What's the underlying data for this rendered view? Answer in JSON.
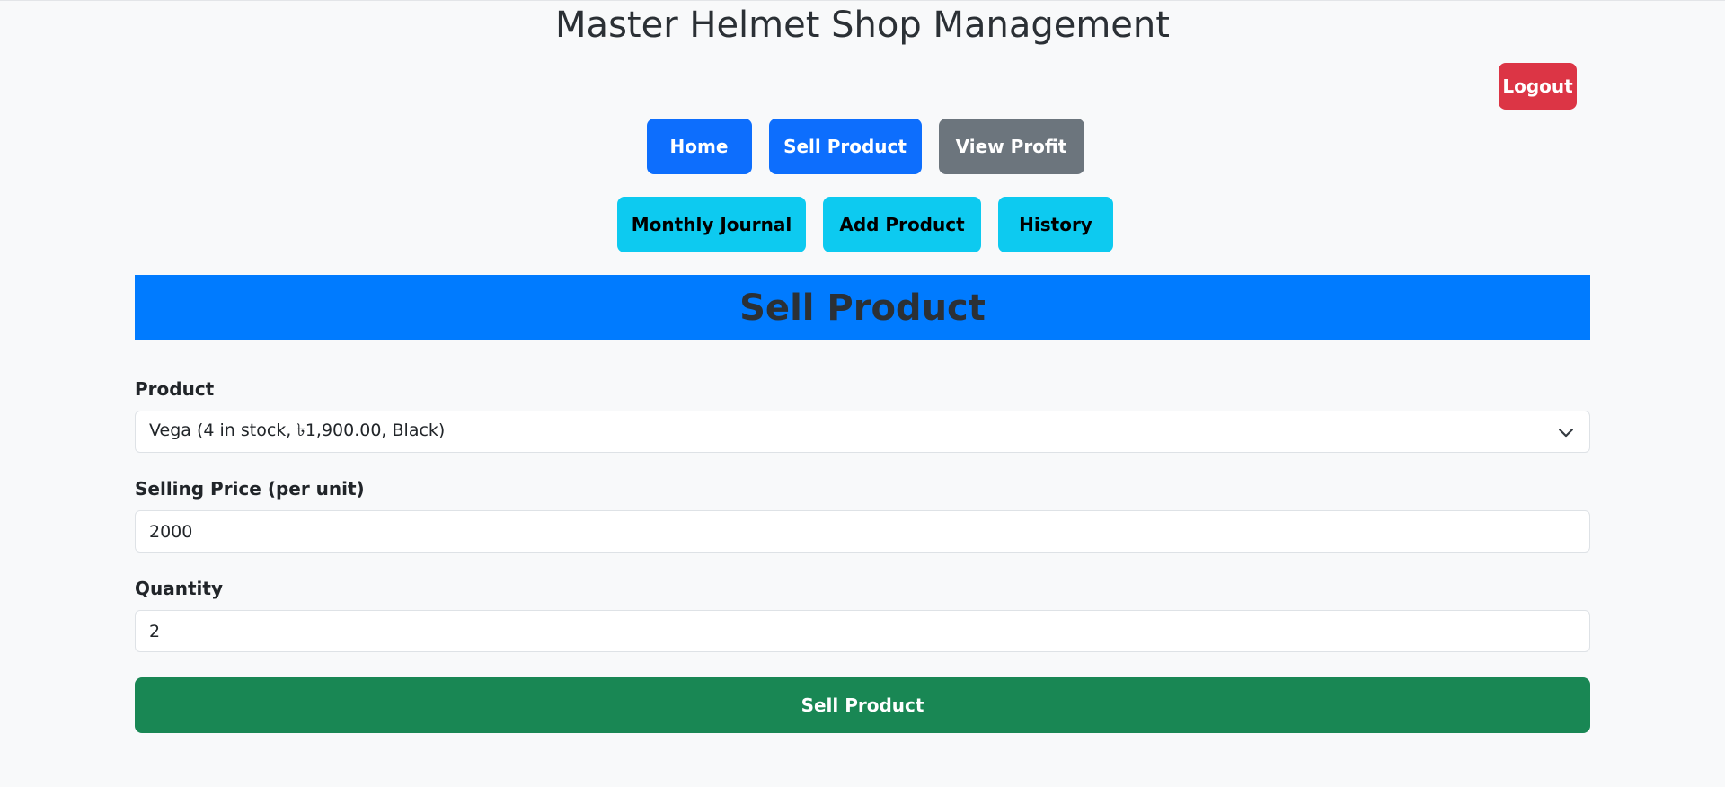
{
  "header": {
    "title": "Master Helmet Shop Management",
    "logout_label": "Logout"
  },
  "nav": {
    "row1": [
      {
        "label": "Home",
        "variant": "primary"
      },
      {
        "label": "Sell Product",
        "variant": "primary"
      },
      {
        "label": "View Profit",
        "variant": "secondary"
      }
    ],
    "row2": [
      {
        "label": "Monthly Journal",
        "variant": "info"
      },
      {
        "label": "Add Product",
        "variant": "info"
      },
      {
        "label": "History",
        "variant": "info"
      }
    ]
  },
  "section": {
    "title": "Sell Product"
  },
  "form": {
    "product": {
      "label": "Product",
      "selected": "Vega (4 in stock, ৳1,900.00, Black)"
    },
    "price": {
      "label": "Selling Price (per unit)",
      "value": "2000"
    },
    "quantity": {
      "label": "Quantity",
      "value": "2"
    },
    "submit_label": "Sell Product"
  },
  "colors": {
    "page_bg": "#f8f9fa",
    "primary": "#0d6efd",
    "secondary": "#6c757d",
    "info": "#0dcaf0",
    "danger": "#dc3545",
    "success": "#198754",
    "header_band": "#007bff"
  }
}
